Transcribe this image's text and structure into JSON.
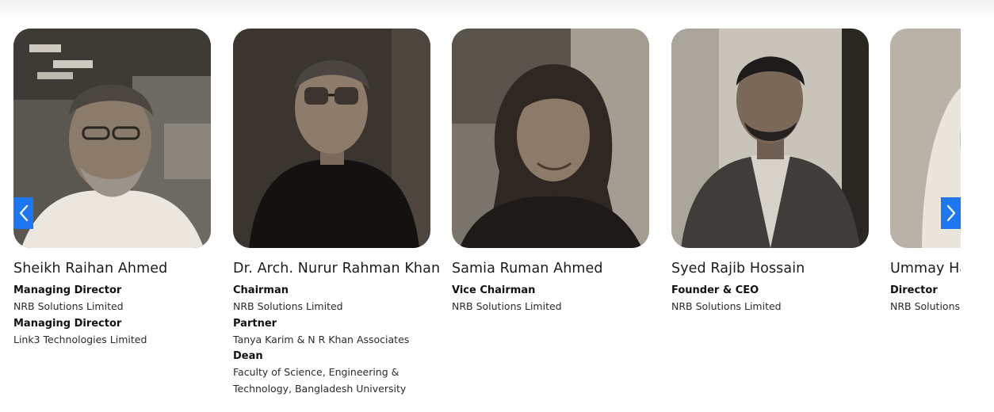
{
  "carousel": {
    "prev_icon": "chevron-left-icon",
    "next_icon": "chevron-right-icon",
    "accent_color": "#1e77f2",
    "members": [
      {
        "name": "Sheikh Raihan Ahmed",
        "roles": [
          {
            "title": "Managing Director",
            "org": "NRB Solutions Limited"
          },
          {
            "title": "Managing Director",
            "org": "Link3 Technologies Limited"
          }
        ]
      },
      {
        "name": "Dr. Arch. Nurur Rahman Khan",
        "roles": [
          {
            "title": "Chairman",
            "org": "NRB Solutions Limited"
          },
          {
            "title": "Partner",
            "org": "Tanya Karim & N R Khan Associates"
          },
          {
            "title": "Dean",
            "org": "Faculty of Science, Engineering & Technology, Bangladesh University"
          }
        ]
      },
      {
        "name": "Samia Ruman Ahmed",
        "roles": [
          {
            "title": "Vice Chairman",
            "org": "NRB Solutions Limited"
          }
        ]
      },
      {
        "name": "Syed Rajib Hossain",
        "roles": [
          {
            "title": "Founder & CEO",
            "org": "NRB Solutions Limited"
          }
        ]
      },
      {
        "name": "Ummay Ha",
        "roles": [
          {
            "title": "Director",
            "org": "NRB Solutions"
          }
        ]
      }
    ]
  }
}
